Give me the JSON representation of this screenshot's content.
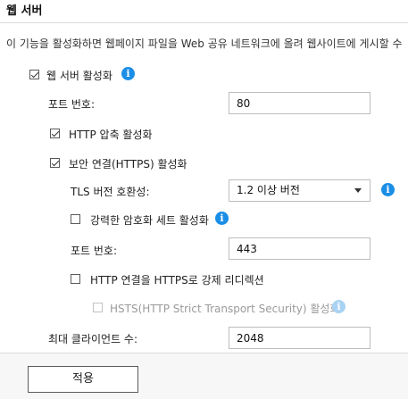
{
  "section_title": "웹 서버",
  "description": "이 기능을 활성화하면 웹페이지 파일을 Web 공유 네트워크에 올려 웹사이트에 게시할 수",
  "enable_web_server": {
    "label": "웹 서버 활성화",
    "checked": true,
    "info_icon": "info-icon"
  },
  "port": {
    "label": "포트 번호:",
    "value": "80"
  },
  "http_compression": {
    "label": "HTTP 압축 활성화",
    "checked": true
  },
  "secure_connection": {
    "label": "보안 연결(HTTPS) 활성화",
    "checked": true
  },
  "tls": {
    "label": "TLS 버전 호환성:",
    "selected": "1.2 이상 버전",
    "info_icon": "info-icon"
  },
  "strong_cipher": {
    "label": "강력한 암호화 세트 활성화",
    "checked": false,
    "info_icon": "info-icon"
  },
  "https_port": {
    "label": "포트 번호:",
    "value": "443"
  },
  "force_https": {
    "label": "HTTP 연결을 HTTPS로 강제 리디렉션",
    "checked": false
  },
  "hsts": {
    "label": "HSTS(HTTP Strict Transport Security) 활성화",
    "checked": false,
    "disabled": true,
    "info_icon": "info-icon"
  },
  "max_clients": {
    "label": "최대 클라이언트 수:",
    "value": "2048"
  },
  "apply_button": "적용",
  "colors": {
    "info": "#1b8ee6",
    "info_disabled": "#a9d3f3",
    "disabled_text": "#9a9a9a"
  }
}
